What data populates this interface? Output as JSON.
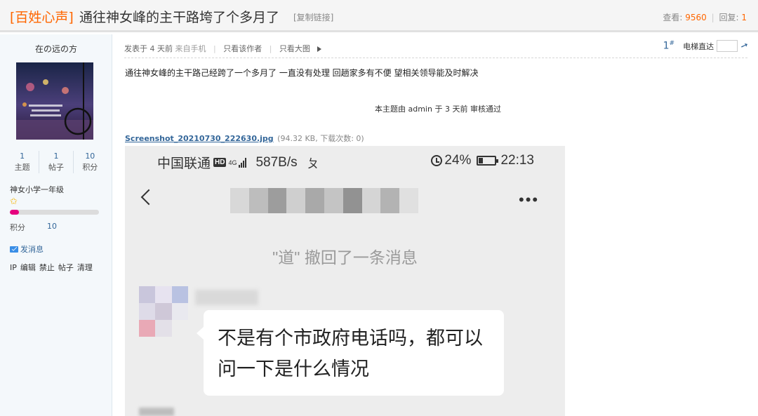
{
  "header": {
    "tag": "[百姓心声]",
    "title": "通往神女峰的主干路垮了个多月了",
    "copy_link": "[复制链接]",
    "views_label": "查看:",
    "views": "9560",
    "replies_label": "回复:",
    "replies": "1"
  },
  "author": {
    "name": "在の远の方",
    "stats": [
      {
        "value": "1",
        "label": "主题"
      },
      {
        "value": "1",
        "label": "帖子"
      },
      {
        "value": "10",
        "label": "积分"
      }
    ],
    "rank": "神女小学一年级",
    "rank_progress": 0.1,
    "points_label": "积分",
    "points": "10",
    "send_message": "发消息",
    "admin_links": [
      "IP",
      "编辑",
      "禁止",
      "帖子",
      "清理"
    ]
  },
  "post": {
    "posted_prefix": "发表于 4 天前",
    "posted_from": "来自手机",
    "only_author": "只看该作者",
    "only_big_image": "只看大图",
    "floor": "1",
    "floor_mark": "#",
    "goto_label": "电梯直达",
    "content": "通往神女峰的主干路己经跨了一个多月了  一直没有处理  回趟家多有不便  望相关领导能及时解决",
    "audit": "本主题由 admin 于 3 天前 审核通过",
    "attachment_name": "Screenshot_20210730_222630.jpg",
    "attachment_info": "(94.32 KB, 下载次数: 0)"
  },
  "screenshot": {
    "carrier": "中国联通",
    "hd": "HD",
    "net": "4G",
    "speed": "587B/s",
    "extra_char": "ㄆ",
    "battery": "24%",
    "time": "22:13",
    "recall_notice": "\"道\" 撤回了一条消息",
    "message": "不是有个市政府电话吗，都可以问一下是什么情况"
  }
}
